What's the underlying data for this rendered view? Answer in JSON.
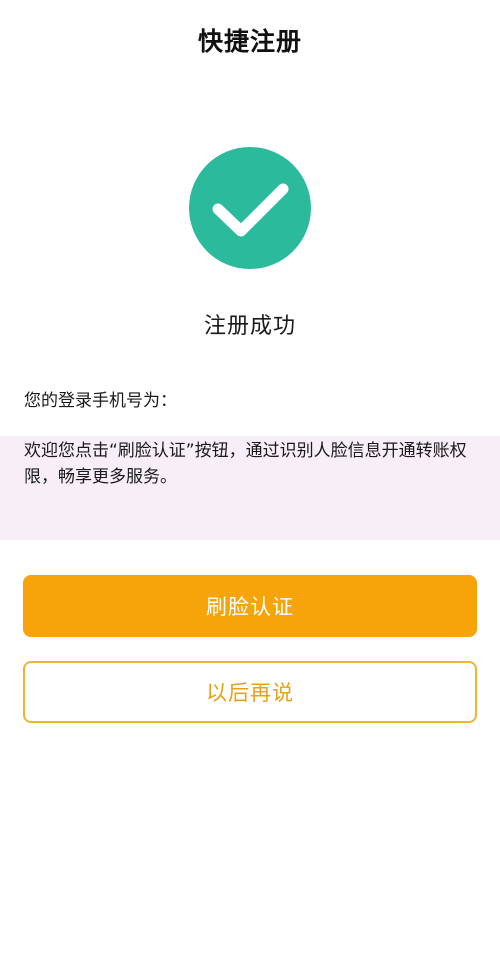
{
  "header": {
    "title": "快捷注册"
  },
  "status": {
    "icon": "check-circle-icon",
    "icon_color": "#2bbb9c",
    "text": "注册成功"
  },
  "account": {
    "phone_label": "您的登录手机号为："
  },
  "notice": {
    "text": "欢迎您点击“刷脸认证”按钮，通过识别人脸信息开通转账权限，畅享更多服务。"
  },
  "actions": {
    "primary_label": "刷脸认证",
    "secondary_label": "以后再说",
    "primary_color": "#f7a40a",
    "secondary_color": "#e8a114"
  }
}
